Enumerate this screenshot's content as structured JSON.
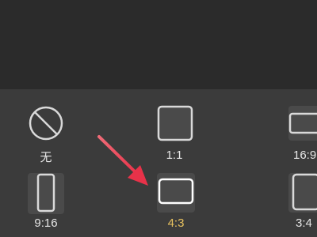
{
  "ratio_options": [
    {
      "id": "none",
      "label": "无",
      "icon": "no-ratio-icon",
      "selected": false
    },
    {
      "id": "1-1",
      "label": "1:1",
      "icon": "square-ratio-icon",
      "selected": false
    },
    {
      "id": "16-9",
      "label": "16:9",
      "icon": "wide-ratio-icon",
      "selected": false
    },
    {
      "id": "9-16",
      "label": "9:16",
      "icon": "tall-ratio-icon",
      "selected": false
    },
    {
      "id": "4-3",
      "label": "4:3",
      "icon": "landscape-ratio-icon",
      "selected": true
    },
    {
      "id": "3-4",
      "label": "3:4",
      "icon": "portrait-ratio-icon",
      "selected": false
    }
  ],
  "colors": {
    "background": "#2b2b2b",
    "panel": "#3b3b3b",
    "label": "#e6e6e6",
    "selected_label": "#e8c25f",
    "arrow": "#f0475d"
  }
}
